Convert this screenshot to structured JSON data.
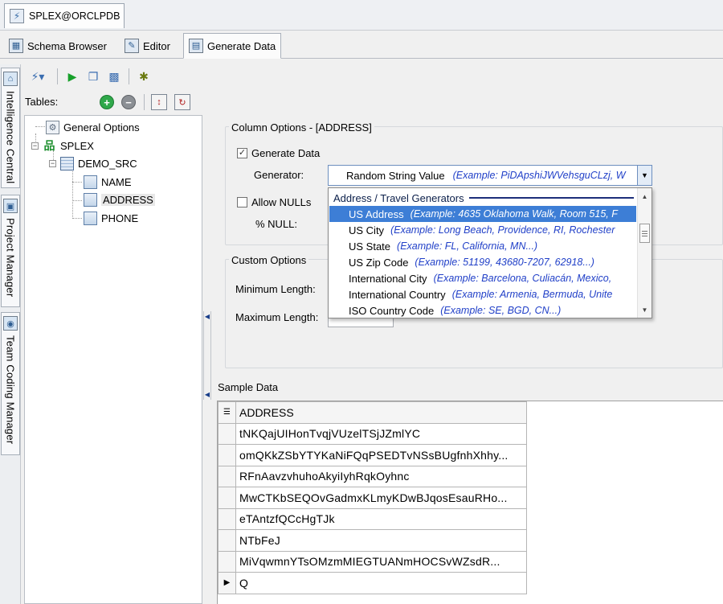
{
  "window": {
    "connection_tab": "SPLEX@ORCLPDB"
  },
  "doc_tabs": [
    {
      "label": "Schema Browser",
      "icon": "schema-browser-icon"
    },
    {
      "label": "Editor",
      "icon": "editor-icon"
    },
    {
      "label": "Generate Data",
      "icon": "generate-data-icon",
      "active": true
    }
  ],
  "side_dock": [
    {
      "label": "Intelligence Central",
      "icon": "intelligence-central-icon"
    },
    {
      "label": "Project Manager",
      "icon": "project-manager-icon"
    },
    {
      "label": "Team Coding Manager",
      "icon": "team-coding-icon"
    }
  ],
  "toolbar": {
    "icons": [
      "connection-dropdown-icon",
      "run-icon",
      "copy-icon",
      "save-icon",
      "beetle-icon"
    ]
  },
  "tables_panel": {
    "label": "Tables:",
    "tree": {
      "general_options": "General Options",
      "schema": "SPLEX",
      "table": "DEMO_SRC",
      "columns": [
        "NAME",
        "ADDRESS",
        "PHONE"
      ],
      "selected_column": "ADDRESS"
    }
  },
  "column_options": {
    "title": "Column Options - [ADDRESS]",
    "generate_data_label": "Generate Data",
    "generate_data_checked": true,
    "generator_label": "Generator:",
    "generator_value": "Random String Value",
    "generator_example": "(Example: PiDApshiJWVehsguCLzj, W",
    "allow_nulls_label": "Allow NULLs",
    "allow_nulls_checked": false,
    "pct_null_label": "% NULL:"
  },
  "generator_list": {
    "group_header": "Address / Travel Generators",
    "items": [
      {
        "name": "US Address",
        "example": "(Example: 4635 Oklahoma Walk, Room 515, F",
        "selected": true
      },
      {
        "name": "US City",
        "example": "(Example: Long Beach, Providence, RI, Rochester"
      },
      {
        "name": "US State",
        "example": "(Example: FL, California, MN...)"
      },
      {
        "name": "US Zip Code",
        "example": "(Example: 51199, 43680-7207, 62918...)"
      },
      {
        "name": "International City",
        "example": "(Example: Barcelona, Culiacán, Mexico,"
      },
      {
        "name": "International Country",
        "example": "(Example: Armenia, Bermuda, Unite"
      },
      {
        "name": "ISO Country Code",
        "example": "(Example: SE, BGD, CN...)"
      }
    ]
  },
  "custom_options": {
    "title": "Custom Options",
    "min_length_label": "Minimum Length:",
    "max_length_label": "Maximum Length:"
  },
  "sample_data": {
    "label": "Sample Data",
    "column_header": "ADDRESS",
    "rows": [
      "tNKQajUIHonTvqjVUzelTSjJZmlYC",
      "omQKkZSbYTYKaNiFQqPSEDTvNSsBUgfnhXhhy...",
      "RFnAavzvhuhoAkyiIyhRqkOyhnc",
      "MwCTKbSEQOvGadmxKLmyKDwBJqosEsauRHo...",
      "eTAntzfQCcHgTJk",
      "NTbFeJ",
      "MiVqwmnYTsOMzmMIEGTUANmHOCSvWZsdR...",
      "Q"
    ],
    "current_row_index": 7
  },
  "colors": {
    "selection": "#3d7ed6",
    "example_text": "#2140c8",
    "group_header_line": "#1c2f7a"
  }
}
